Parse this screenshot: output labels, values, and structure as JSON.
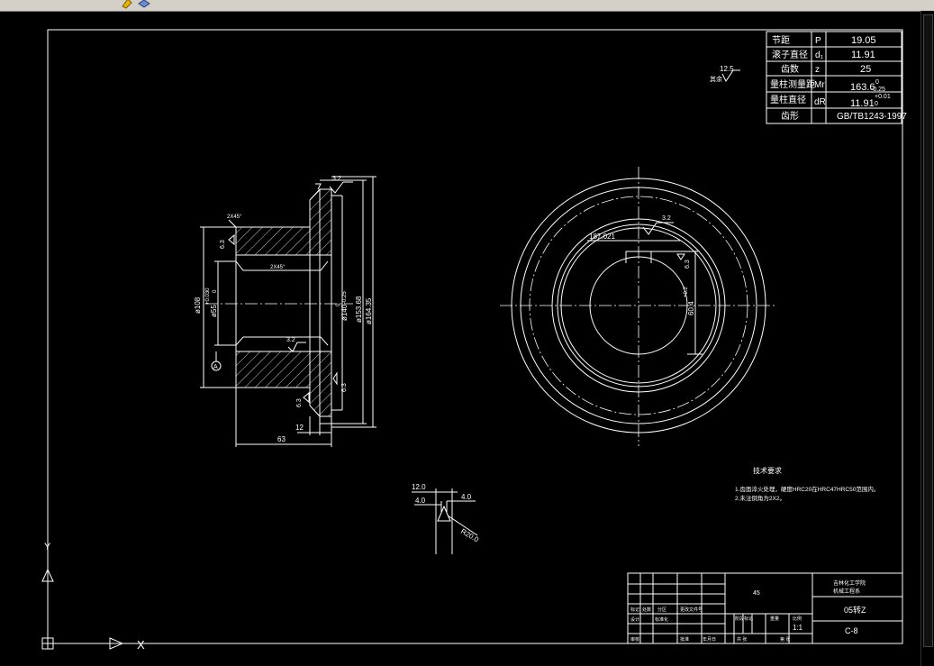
{
  "table": {
    "rows": [
      {
        "name": "节距",
        "symbol": "P",
        "value": "19.05"
      },
      {
        "name": "滚子直径",
        "symbol": "d₁",
        "value": "11.91"
      },
      {
        "name": "齿数",
        "symbol": "z",
        "value": "25"
      },
      {
        "name": "量柱测量距",
        "symbol": "Mr",
        "value": "163.6",
        "tol_up": "0",
        "tol_dn": "-0.25"
      },
      {
        "name": "量柱直径",
        "symbol": "dR",
        "value": "11.91",
        "tol_up": "+0.01",
        "tol_dn": "0"
      },
      {
        "name": "齿形",
        "symbol": "",
        "value": "GB/TB1243-1997"
      }
    ]
  },
  "roughness_general": {
    "value": "12.5",
    "label": "其余"
  },
  "side_view": {
    "chamfer_top": "2X45°",
    "chamfer_inner": "2X45°",
    "rough_top": "3.2",
    "rough_left": "6.3",
    "rough_bore": "3.2",
    "rough_bottom": "6.3",
    "rough_face": "6.3",
    "dim_d108": "ø108",
    "dim_d55": "ø55",
    "dim_d55_tol": "+0.030",
    "dim_d55_tol2": "0",
    "dim_d140": "ø140",
    "dim_d140_tol": "0",
    "dim_d140_tol2": "-0.25",
    "dim_d153": "ø153.68",
    "dim_d164": "ø164.35",
    "datum": "A",
    "dim_12": "12",
    "dim_63": "63"
  },
  "front_view": {
    "chord": "187.021",
    "rough_key": "3.2",
    "rough_side": "6.3",
    "key_depth": "60.4",
    "key_tol": "+0.2"
  },
  "tooth_detail": {
    "w_total": "12.0",
    "w_left": "4.0",
    "w_right": "4.0",
    "radius": "R20.0"
  },
  "notes": {
    "title": "技术要求",
    "items": [
      "1.齿面淬火处理，硬度HRC20在HRC47HRC50范围内。",
      "2.未注倒角为2X2。"
    ]
  },
  "titleblock": {
    "school": "吉林化工学院",
    "dept": "机械工程系",
    "code": "05转Z",
    "material": "45",
    "scale": "1:1",
    "drawing_no": "C-8",
    "labels": [
      "标记",
      "处数",
      "分区",
      "更改文件号",
      "签名",
      "年月日",
      "设计",
      "标准化",
      "审核",
      "工艺",
      "批准",
      "阶段标记",
      "重量",
      "比例",
      "共 张",
      "第 张"
    ]
  },
  "ucs": {
    "y_label": "Y",
    "x_label": "X"
  }
}
